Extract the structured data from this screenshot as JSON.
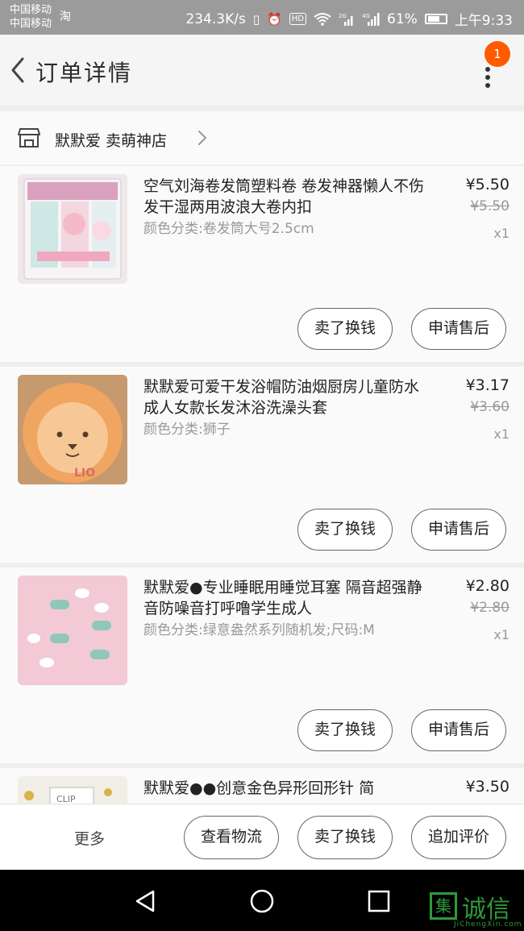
{
  "status_bar": {
    "carrier1": "中国移动",
    "carrier2": "中国移动",
    "taobao_icon": "淘",
    "speed": "234.3K/s",
    "battery": "61%",
    "time": "上午9:33"
  },
  "header": {
    "title": "订单详情",
    "badge_count": "1"
  },
  "shop": {
    "name": "默默爱 卖萌神店"
  },
  "items": [
    {
      "title": "空气刘海卷发筒塑料卷 卷发神器懒人不伤发干湿两用波浪大卷内扣",
      "sku": "颜色分类:卷发筒大号2.5cm",
      "price": "¥5.50",
      "original_price": "¥5.50",
      "qty": "x1",
      "sell_label": "卖了换钱",
      "aftersale_label": "申请售后"
    },
    {
      "title": "默默爱可爱干发浴帽防油烟厨房儿童防水成人女款长发沐浴洗澡头套",
      "sku": "颜色分类:狮子",
      "price": "¥3.17",
      "original_price": "¥3.60",
      "qty": "x1",
      "sell_label": "卖了换钱",
      "aftersale_label": "申请售后"
    },
    {
      "title": "默默爱●专业睡眠用睡觉耳塞 隔音超强静音防噪音打呼噜学生成人",
      "sku": "颜色分类:绿意盎然系列随机发;尺码:M",
      "price": "¥2.80",
      "original_price": "¥2.80",
      "qty": "x1",
      "sell_label": "卖了换钱",
      "aftersale_label": "申请售后"
    },
    {
      "title": "默默爱●●创意金色异形回形针 简",
      "price": "¥3.50"
    }
  ],
  "bottom_bar": {
    "more": "更多",
    "logistics": "查看物流",
    "sell": "卖了换钱",
    "review": "追加评价"
  },
  "watermark": {
    "box_char": "集",
    "name": "诚信",
    "url": "JiChengXin.com"
  },
  "colors": {
    "badge": "#ff5a00",
    "status_bar": "#9b9b9b",
    "watermark": "#2f9a3a"
  },
  "icons": [
    "back-arrow-icon",
    "more-vert-icon",
    "store-icon",
    "chevron-right-icon",
    "nav-back-icon",
    "nav-home-icon",
    "nav-recents-icon"
  ]
}
